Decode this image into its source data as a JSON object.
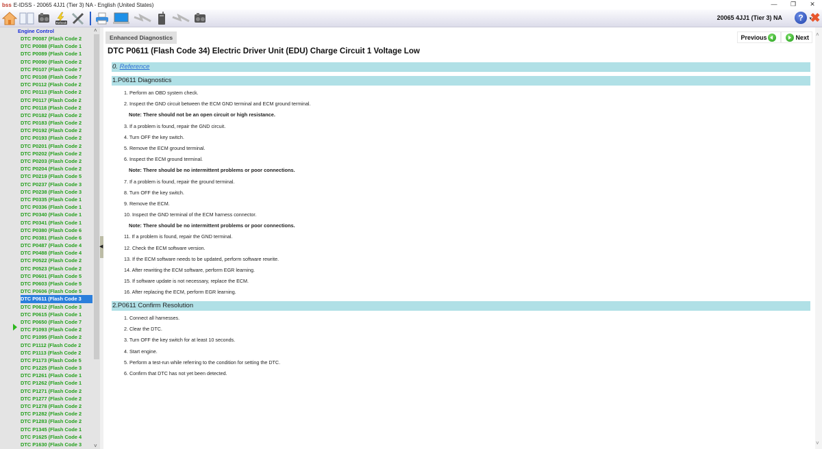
{
  "window": {
    "title": "E-IDSS - 20065 4JJ1 (Tier 3)  NA - English (United States)",
    "logo": "bss",
    "minimize": "—",
    "restore": "❐",
    "close": "✕"
  },
  "toolbar": {
    "buttons": [
      {
        "name": "home-icon"
      },
      {
        "name": "book-icon"
      },
      {
        "name": "engine-icon"
      },
      {
        "name": "refresh-icon",
        "label": "Refresh"
      },
      {
        "name": "tools-icon"
      },
      {
        "name": "printer-icon"
      },
      {
        "name": "laptop-icon"
      },
      {
        "name": "link-icon"
      },
      {
        "name": "interface-device-icon"
      },
      {
        "name": "link-icon"
      },
      {
        "name": "engine-icon"
      }
    ],
    "vehicle_info": "20065 4JJ1 (Tier 3)  NA",
    "help_label": "?",
    "help_caret": "▾",
    "exit_label": "✖"
  },
  "sidebar": {
    "group": "Engine Control",
    "selected_index": 35,
    "items": [
      "DTC P0087 (Flash Code 2",
      "DTC P0088 (Flash Code 1",
      "DTC P0089 (Flash Code 1",
      "DTC P0090 (Flash Code 2",
      "DTC P0107 (Flash Code 7",
      "DTC P0108 (Flash Code 7",
      "DTC P0112 (Flash Code 2",
      "DTC P0113 (Flash Code 2",
      "DTC P0117 (Flash Code 2",
      "DTC P0118 (Flash Code 2",
      "DTC P0182 (Flash Code 2",
      "DTC P0183 (Flash Code 2",
      "DTC P0192 (Flash Code 2",
      "DTC P0193 (Flash Code 2",
      "DTC P0201 (Flash Code 2",
      "DTC P0202 (Flash Code 2",
      "DTC P0203 (Flash Code 2",
      "DTC P0204 (Flash Code 2",
      "DTC P0219 (Flash Code 5",
      "DTC P0237 (Flash Code 3",
      "DTC P0238 (Flash Code 3",
      "DTC P0335 (Flash Code 1",
      "DTC P0336 (Flash Code 1",
      "DTC P0340 (Flash Code 1",
      "DTC P0341 (Flash Code 1",
      "DTC P0380 (Flash Code 6",
      "DTC P0381 (Flash Code 6",
      "DTC P0487 (Flash Code 4",
      "DTC P0488 (Flash Code 4",
      "DTC P0522 (Flash Code 2",
      "DTC P0523 (Flash Code 2",
      "DTC P0601 (Flash Code 5",
      "DTC P0603 (Flash Code 5",
      "DTC P0606 (Flash Code 5",
      "DTC P0611 (Flash Code 3",
      "DTC P0612 (Flash Code 3",
      "DTC P0615 (Flash Code 1",
      "DTC P0650 (Flash Code 7",
      "DTC P1093 (Flash Code 2",
      "DTC P1095 (Flash Code 2",
      "DTC P1112 (Flash Code 2",
      "DTC P1113 (Flash Code 2",
      "DTC P1173 (Flash Code 5",
      "DTC P1225 (Flash Code 3",
      "DTC P1261 (Flash Code 1",
      "DTC P1262 (Flash Code 1",
      "DTC P1271 (Flash Code 2",
      "DTC P1277 (Flash Code 2",
      "DTC P1278 (Flash Code 2",
      "DTC P1282 (Flash Code 2",
      "DTC P1283 (Flash Code 2",
      "DTC P1345 (Flash Code 1",
      "DTC P1625 (Flash Code 4",
      "DTC P1630 (Flash Code 3"
    ]
  },
  "main": {
    "tab": "Enhanced Diagnostics",
    "previous": "Previous",
    "next": "Next",
    "title": "DTC P0611 (Flash Code 34) Electric Driver Unit (EDU) Charge Circuit 1 Voltage Low",
    "reference": {
      "num": "0.",
      "label": "Reference"
    },
    "diagnostics": {
      "heading": "1.P0611 Diagnostics",
      "steps": [
        {
          "text": "1. Perform an OBD system check."
        },
        {
          "text": "2. Inspect the GND circuit between the ECM GND terminal and ECM ground terminal."
        },
        {
          "text": "Note: There should not be an open circuit or high resistance.",
          "note": true
        },
        {
          "text": "3. If a problem is found, repair the GND circuit."
        },
        {
          "text": "4. Turn OFF the key switch."
        },
        {
          "text": "5. Remove the ECM ground terminal."
        },
        {
          "text": "6. Inspect the ECM ground terminal."
        },
        {
          "text": "Note: There should be no intermittent problems or poor connections.",
          "note": true
        },
        {
          "text": "7. If a problem is found, repair the ground terminal."
        },
        {
          "text": "8. Turn OFF the key switch."
        },
        {
          "text": "9. Remove the ECM."
        },
        {
          "text": "10. Inspect the GND terminal of the ECM harness connector."
        },
        {
          "text": "Note: There should be no intermittent problems or poor connections.",
          "note": true
        },
        {
          "text": "11. If a problem is found, repair the GND terminal."
        },
        {
          "text": "12. Check the ECM software version."
        },
        {
          "text": "13. If the ECM software needs to be updated, perform software rewrite."
        },
        {
          "text": "14. After rewriting the ECM software, perform EGR learning."
        },
        {
          "text": "15. If software update is not necessary, replace the ECM."
        },
        {
          "text": "16. After replacing the ECM, perform EGR learning."
        }
      ]
    },
    "confirm": {
      "heading": "2.P0611 Confirm Resolution",
      "steps": [
        {
          "text": "1. Connect all harnesses."
        },
        {
          "text": "2. Clear the DTC."
        },
        {
          "text": "3. Turn OFF the key switch for at least 10 seconds."
        },
        {
          "text": "4. Start engine."
        },
        {
          "text": "5. Perform a test-run while referring to the condition for setting the DTC."
        },
        {
          "text": "6. Confirm that DTC has not yet been detected."
        }
      ]
    }
  },
  "colors": {
    "section_bg": "#b0e0e6",
    "dtc_text": "#23a01c",
    "selected_bg": "#2b7fdc",
    "group_text": "#1b2fd8"
  }
}
